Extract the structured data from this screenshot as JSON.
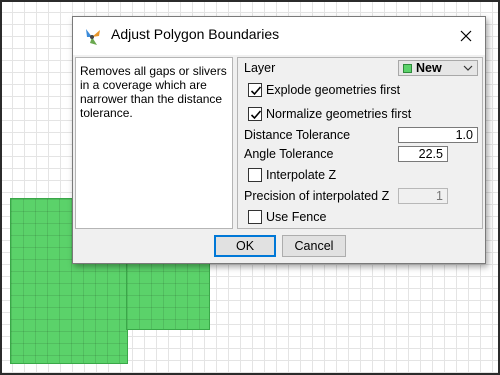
{
  "dialog": {
    "title": "Adjust Polygon Boundaries",
    "close_icon": "close-icon",
    "app_icon": "jump-plugin-icon",
    "description": "Removes all gaps or slivers in a coverage which are narrower than the distance tolerance.",
    "layer": {
      "label": "Layer",
      "value": "New",
      "swatch_color": "#5bd26a"
    },
    "explode": {
      "label": "Explode geometries first",
      "checked": true
    },
    "normalize": {
      "label": "Normalize geometries first",
      "checked": true
    },
    "distance_tolerance": {
      "label": "Distance Tolerance",
      "value": "1.0"
    },
    "angle_tolerance": {
      "label": "Angle Tolerance",
      "value": "22.5"
    },
    "interpolate_z": {
      "label": "Interpolate Z",
      "checked": false
    },
    "precision_z": {
      "label": "Precision of interpolated Z",
      "value": "1"
    },
    "use_fence": {
      "label": "Use Fence",
      "checked": false
    },
    "ok_label": "OK",
    "cancel_label": "Cancel"
  },
  "canvas": {
    "polygon_color": "#5bd26a",
    "grid_color": "#e4e4e4"
  }
}
